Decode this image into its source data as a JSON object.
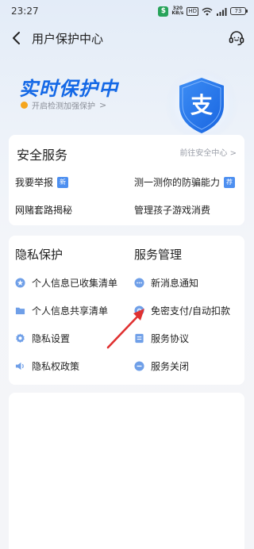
{
  "status_bar": {
    "time": "23:27",
    "speed_top": "320",
    "speed_bottom": "KB/s",
    "hd": "HD",
    "battery": "73"
  },
  "nav": {
    "title": "用户保护中心"
  },
  "hero": {
    "title": "实时保护中",
    "subtitle": "开启检测加强保护",
    "shield_char": "支"
  },
  "security": {
    "title": "安全服务",
    "link": "前往安全中心 >",
    "items": [
      {
        "label": "我要举报",
        "tag": "新"
      },
      {
        "label": "测一测你的防骗能力",
        "tag": "荐"
      },
      {
        "label": "网赌套路揭秘"
      },
      {
        "label": "管理孩子游戏消费"
      }
    ]
  },
  "privacy": {
    "title": "隐私保护",
    "items": [
      {
        "label": "个人信息已收集清单",
        "icon": "star-circle-icon"
      },
      {
        "label": "个人信息共享清单",
        "icon": "folder-icon"
      },
      {
        "label": "隐私设置",
        "icon": "gear-icon"
      },
      {
        "label": "隐私权政策",
        "icon": "speaker-icon"
      }
    ]
  },
  "service": {
    "title": "服务管理",
    "items": [
      {
        "label": "新消息通知",
        "icon": "chat-bubble-icon"
      },
      {
        "label": "免密支付/自动扣款",
        "icon": "payment-icon"
      },
      {
        "label": "服务协议",
        "icon": "document-icon"
      },
      {
        "label": "服务关闭",
        "icon": "minus-circle-icon"
      }
    ]
  },
  "colors": {
    "accent": "#1468e6",
    "icon_blue": "#6f9fe8",
    "arrow_red": "#e03131"
  }
}
